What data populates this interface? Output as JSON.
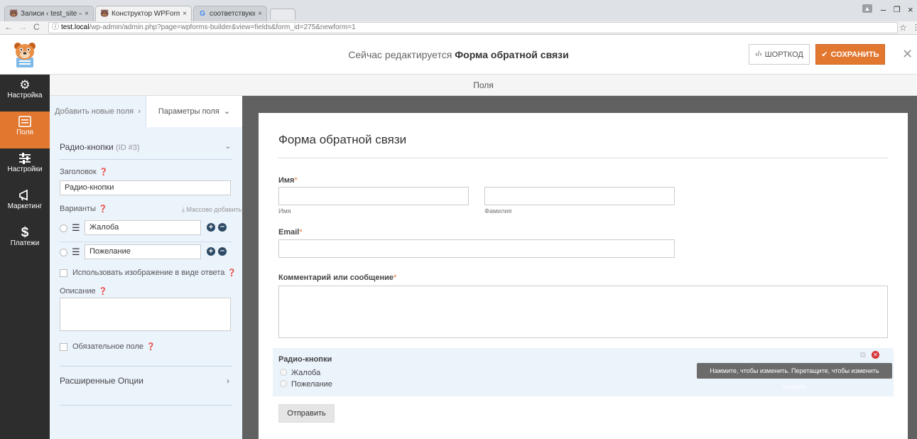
{
  "browser": {
    "tabs": [
      {
        "title": "Записи ‹ test_site — Wo",
        "close": "×"
      },
      {
        "title": "Конструктор WPForms ·",
        "close": "×"
      },
      {
        "title": "соответствующей - Поиск",
        "close": "×"
      }
    ],
    "url_host": "test.local",
    "url_path": "/wp-admin/admin.php?page=wpforms-builder&view=fields&form_id=275&newform=1"
  },
  "header": {
    "editing_prefix": "Сейчас редактируется",
    "form_name": "Форма обратной связи",
    "shortcode_label": "ШОРТКОД",
    "save_label": "СОХРАНИТЬ"
  },
  "sidebar": {
    "items": [
      {
        "label": "Настройка",
        "icon": "gear-icon"
      },
      {
        "label": "Поля",
        "icon": "fields-icon"
      },
      {
        "label": "Настройки",
        "icon": "sliders-icon"
      },
      {
        "label": "Маркетинг",
        "icon": "megaphone-icon"
      },
      {
        "label": "Платежи",
        "icon": "dollar-icon"
      }
    ]
  },
  "panel_title": "Поля",
  "options": {
    "tab_add": "Добавить новые поля",
    "tab_options": "Параметры поля",
    "field_name": "Радио-кнопки",
    "field_id": "(ID #3)",
    "label_title": "Заголовок",
    "label_value": "Радио-кнопки",
    "choices_title": "Варианты",
    "bulk_add": "Массово добавить",
    "choices": [
      "Жалоба",
      "Пожелание"
    ],
    "use_image": "Использовать изображение в виде ответа",
    "description_title": "Описание",
    "required": "Обязательное поле",
    "advanced": "Расширенные Опции"
  },
  "preview": {
    "title": "Форма обратной связи",
    "name_label": "Имя",
    "first_sub": "Имя",
    "last_sub": "Фамилия",
    "email_label": "Email",
    "comment_label": "Комментарий или сообщение",
    "radio_label": "Радио-кнопки",
    "radio_options": [
      "Жалоба",
      "Пожелание"
    ],
    "tooltip": "Нажмите, чтобы изменить. Перетащите, чтобы изменить порядок.",
    "submit": "Отправить",
    "required_mark": "*"
  },
  "colors": {
    "accent": "#e27730",
    "sidebar": "#2d2d2d",
    "options_bg": "#ebf3fb",
    "preview_bg": "#616161"
  }
}
